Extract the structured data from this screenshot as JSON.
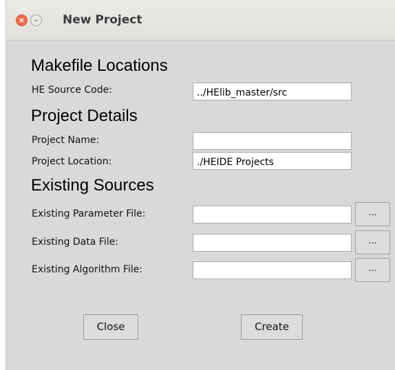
{
  "window": {
    "title": "New Project",
    "close_glyph": "×",
    "minimize_glyph": "–"
  },
  "sections": {
    "makefile": {
      "heading": "Makefile Locations",
      "he_source_label": "HE Source Code:",
      "he_source_value": "../HElib_master/src"
    },
    "project": {
      "heading": "Project Details",
      "name_label": "Project Name:",
      "name_value": "",
      "location_label": "Project Location:",
      "location_value": "./HEIDE Projects"
    },
    "existing": {
      "heading": "Existing Sources",
      "parameter_label": "Existing Parameter File:",
      "parameter_value": "",
      "data_label": "Existing Data File:",
      "data_value": "",
      "algorithm_label": "Existing Algorithm File:",
      "algorithm_value": "",
      "browse_label": "..."
    }
  },
  "actions": {
    "close_label": "Close",
    "create_label": "Create"
  }
}
